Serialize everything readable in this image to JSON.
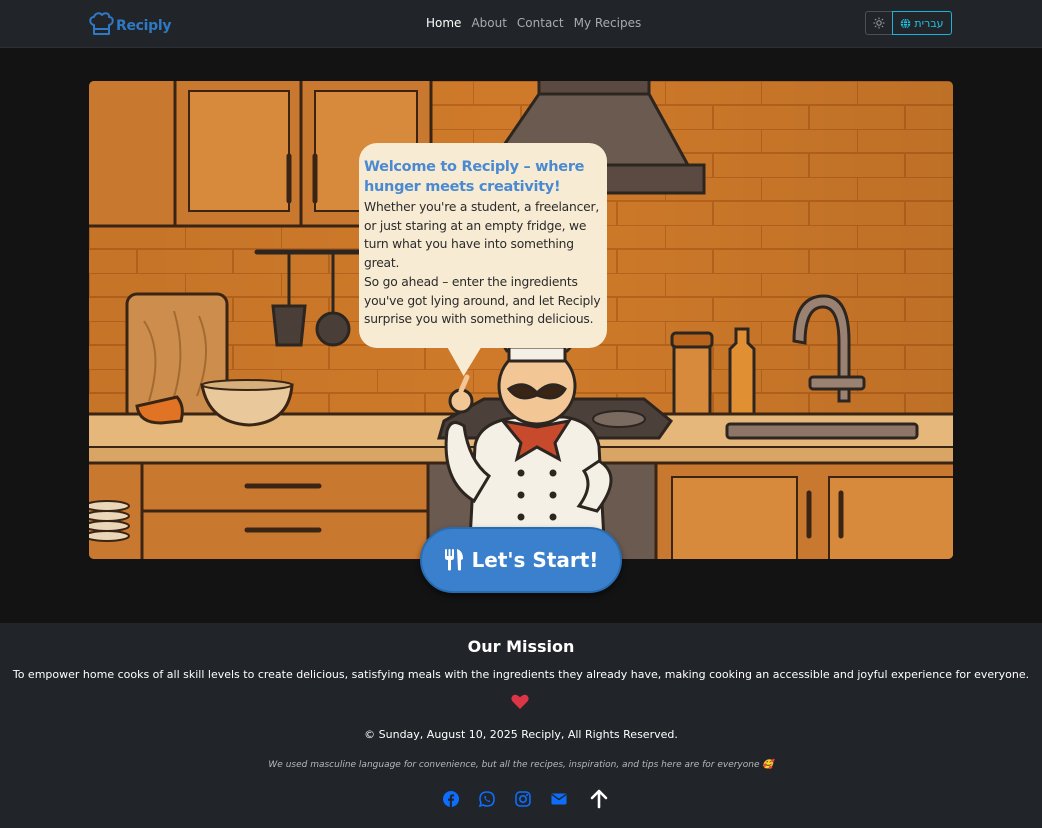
{
  "brand": {
    "name": "Reciply",
    "icon": "chef-hat-icon"
  },
  "nav": {
    "links": [
      "Home",
      "About",
      "Contact",
      "My Recipes"
    ],
    "active": "Home"
  },
  "actions": {
    "theme_icon": "sun-icon",
    "lang_label": "עברית",
    "lang_icon": "globe-icon"
  },
  "hero": {
    "bubble_title": "Welcome to Reciply – where hunger meets creativity!",
    "bubble_p1": "Whether you're a student, a freelancer, or just staring at an empty fridge, we turn what you have into something great.",
    "bubble_p2": "So go ahead – enter the ingredients you've got lying around, and let Reciply surprise you with something delicious.",
    "cta_label": "Let's Start!",
    "cta_icon": "fork-knife-icon"
  },
  "footer": {
    "mission_title": "Our Mission",
    "mission_text": "To empower home cooks of all skill levels to create delicious, satisfying meals with the ingredients they already have, making cooking an accessible and joyful experience for everyone.",
    "copyright": "© Sunday, August 10, 2025 Reciply, All Rights Reserved.",
    "note": "We used masculine language for convenience, but all the recipes, inspiration, and tips here are for everyone 🥰",
    "socials": [
      "facebook-icon",
      "whatsapp-icon",
      "instagram-icon",
      "envelope-icon",
      "arrow-up-icon"
    ]
  },
  "colors": {
    "brand": "#2f78c4",
    "cta": "#3a80cd",
    "heart": "#dc3545",
    "lang": "#22c2e4",
    "footer_bg": "#212529"
  }
}
